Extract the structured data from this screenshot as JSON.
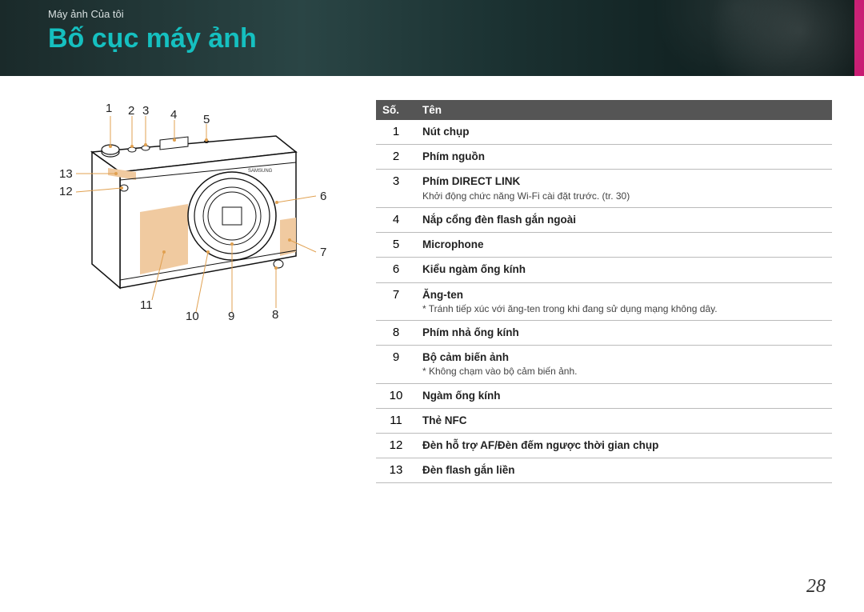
{
  "breadcrumb": "Máy ảnh Của tôi",
  "title": "Bố cục máy ảnh",
  "page_number": "28",
  "callouts": {
    "c1": "1",
    "c2": "2",
    "c3": "3",
    "c4": "4",
    "c5": "5",
    "c6": "6",
    "c7": "7",
    "c8": "8",
    "c9": "9",
    "c10": "10",
    "c11": "11",
    "c12": "12",
    "c13": "13"
  },
  "table": {
    "header_num": "Số.",
    "header_name": "Tên",
    "rows": [
      {
        "num": "1",
        "name": "Nút chụp"
      },
      {
        "num": "2",
        "name": "Phím nguồn"
      },
      {
        "num": "3",
        "name": "Phím DIRECT LINK",
        "note": "Khởi động chức năng Wi-Fi cài đặt trước. (tr. 30)"
      },
      {
        "num": "4",
        "name": "Nắp cổng đèn flash gắn ngoài"
      },
      {
        "num": "5",
        "name": "Microphone"
      },
      {
        "num": "6",
        "name": "Kiểu ngàm ống kính"
      },
      {
        "num": "7",
        "name": "Ăng-ten",
        "note": "* Tránh tiếp xúc với ăng-ten trong khi đang sử dụng mạng không dây."
      },
      {
        "num": "8",
        "name": "Phím nhả ống kính"
      },
      {
        "num": "9",
        "name": "Bộ cảm biến ảnh",
        "note": "* Không chạm vào bộ cảm biến ảnh."
      },
      {
        "num": "10",
        "name": "Ngàm ống kính"
      },
      {
        "num": "11",
        "name": "Thẻ NFC"
      },
      {
        "num": "12",
        "name": "Đèn hỗ trợ AF/Đèn đếm ngược thời gian chụp"
      },
      {
        "num": "13",
        "name": "Đèn flash gắn liền"
      }
    ]
  }
}
